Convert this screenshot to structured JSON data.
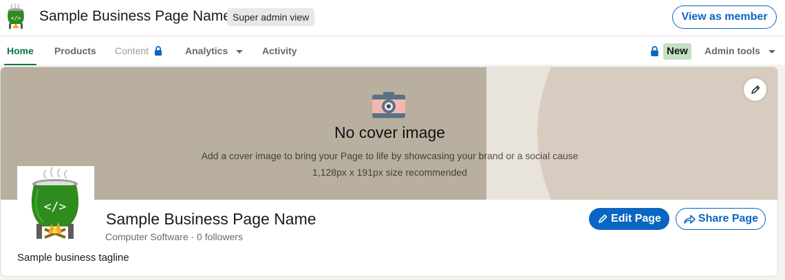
{
  "header": {
    "page_name": "Sample Business Page Name",
    "view_badge": "Super admin view",
    "view_as_member_label": "View as member"
  },
  "nav": {
    "items": [
      {
        "label": "Home",
        "active": true
      },
      {
        "label": "Products"
      },
      {
        "label": "Content",
        "locked": true
      },
      {
        "label": "Analytics",
        "dropdown": true
      },
      {
        "label": "Activity"
      }
    ],
    "new_badge": "New",
    "admin_tools_label": "Admin tools"
  },
  "cover": {
    "title": "No cover image",
    "description": "Add a cover image to bring your Page to life by showcasing your brand or a social cause",
    "size_hint": "1,128px x 191px size recommended"
  },
  "profile": {
    "name": "Sample Business Page Name",
    "meta": "Computer Software · 0 followers",
    "tagline": "Sample business tagline",
    "edit_label": "Edit Page",
    "share_label": "Share Page"
  },
  "colors": {
    "primary": "#0a66c2",
    "active_nav": "#057642",
    "new_badge_bg": "#c4dfc4",
    "cover_bg": "#b9af9f",
    "logo_green": "#2e8b1e"
  }
}
